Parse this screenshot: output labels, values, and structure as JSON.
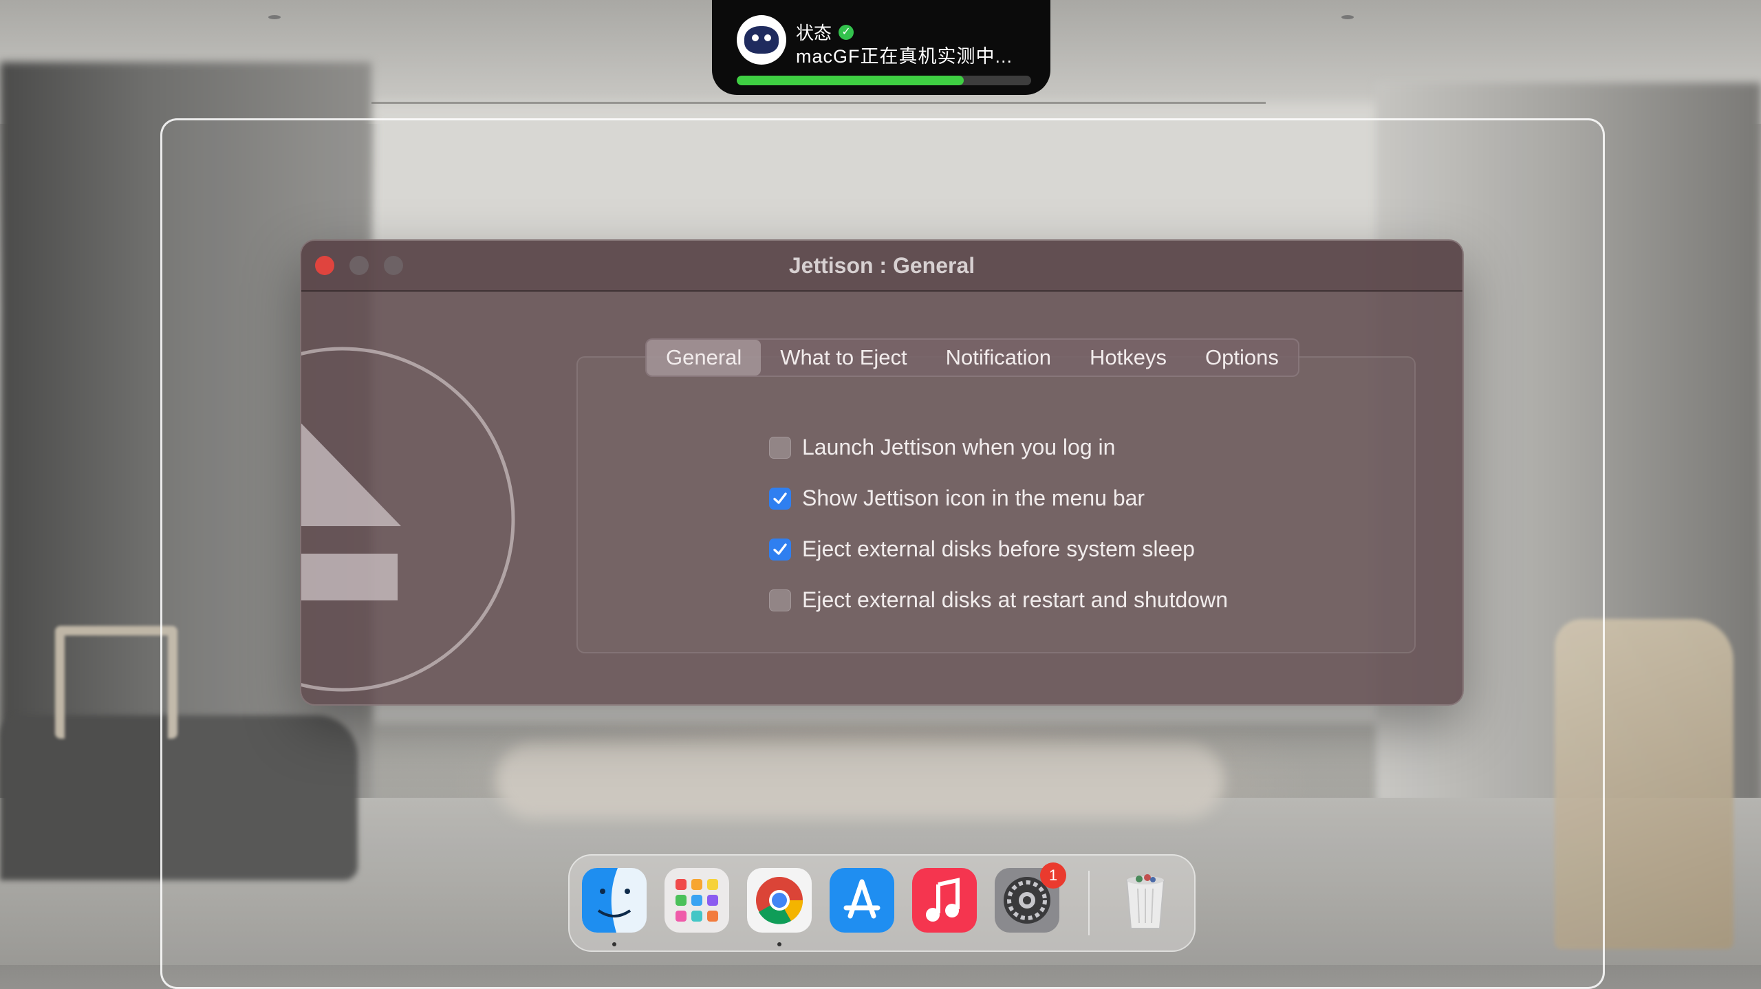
{
  "status": {
    "title": "状态",
    "message": "macGF正在真机实测中...",
    "progress_pct": 77,
    "check_icon": "check-circle-icon"
  },
  "window": {
    "title": "Jettison : General",
    "tabs": [
      {
        "label": "General",
        "active": true
      },
      {
        "label": "What to Eject",
        "active": false
      },
      {
        "label": "Notification",
        "active": false
      },
      {
        "label": "Hotkeys",
        "active": false
      },
      {
        "label": "Options",
        "active": false
      }
    ],
    "options": [
      {
        "label": "Launch Jettison when you log in",
        "checked": false
      },
      {
        "label": "Show Jettison icon in the menu bar",
        "checked": true
      },
      {
        "label": "Eject external disks before system sleep",
        "checked": true
      },
      {
        "label": "Eject external disks at restart and shutdown",
        "checked": false
      }
    ]
  },
  "dock": {
    "apps": [
      {
        "name": "finder-icon",
        "running": true
      },
      {
        "name": "launchpad-icon",
        "running": false
      },
      {
        "name": "chrome-icon",
        "running": true
      },
      {
        "name": "app-store-icon",
        "running": false
      },
      {
        "name": "music-icon",
        "running": false
      },
      {
        "name": "system-settings-icon",
        "running": false,
        "badge": "1"
      },
      {
        "name": "trash-icon",
        "running": false
      }
    ]
  },
  "colors": {
    "accent": "#2f7ff0",
    "close": "#e0443e",
    "progress": "#3fcf43"
  }
}
